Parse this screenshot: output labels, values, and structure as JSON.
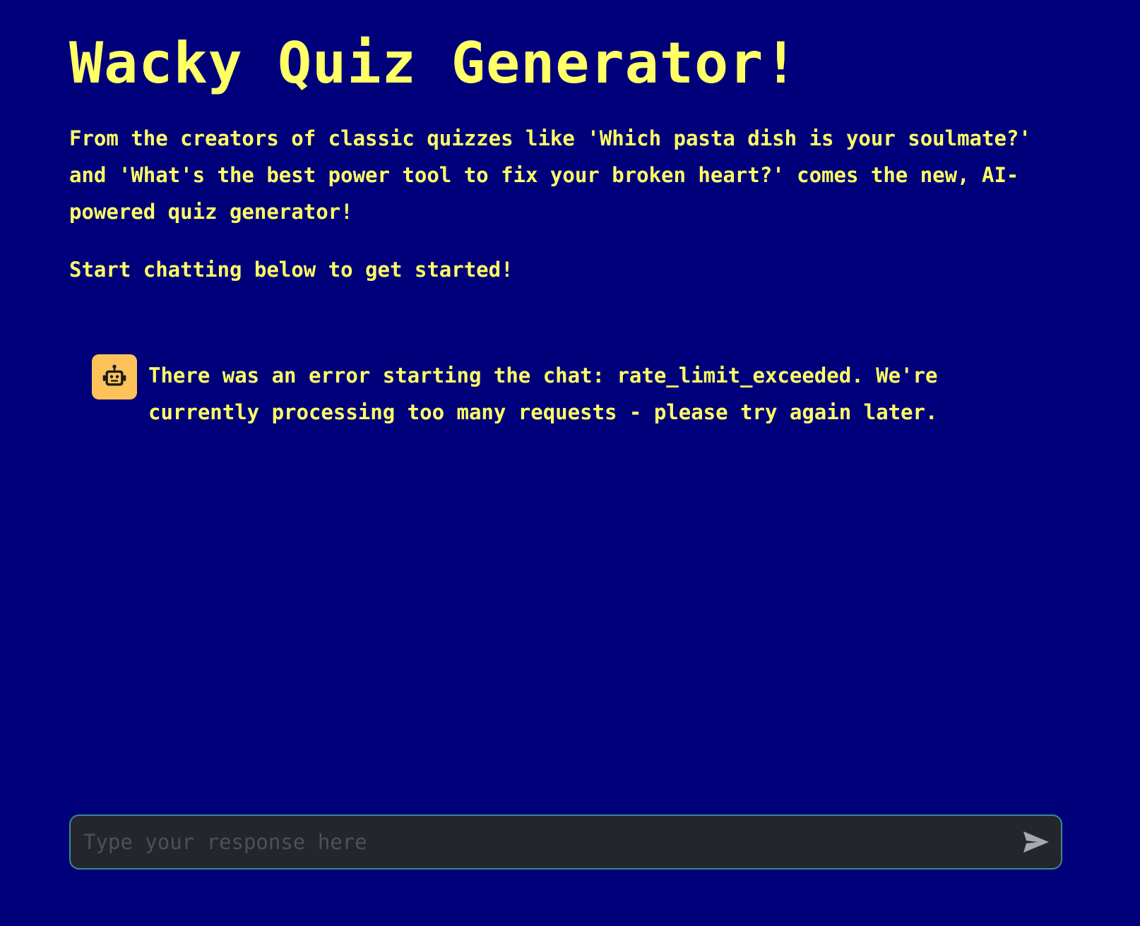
{
  "header": {
    "title": "Wacky Quiz Generator!"
  },
  "intro": {
    "text": "From the creators of classic quizzes like 'Which pasta dish is your soulmate?' and 'What's the best power tool to fix your broken heart?' comes the new, AI-powered quiz generator!",
    "cta": "Start chatting below to get started!"
  },
  "chat": {
    "messages": [
      {
        "sender_icon": "robot-icon",
        "text": "There was an error starting the chat: rate_limit_exceeded. We're currently processing too many requests - please try again later."
      }
    ]
  },
  "composer": {
    "value": "",
    "placeholder": "Type your response here",
    "send_icon": "send-icon"
  },
  "colors": {
    "background": "#00007a",
    "text": "#ffff66",
    "avatar": "#fdc35a",
    "input_background": "#25262d",
    "input_border": "#3a8a8a",
    "send_icon": "#a7a8b0"
  }
}
